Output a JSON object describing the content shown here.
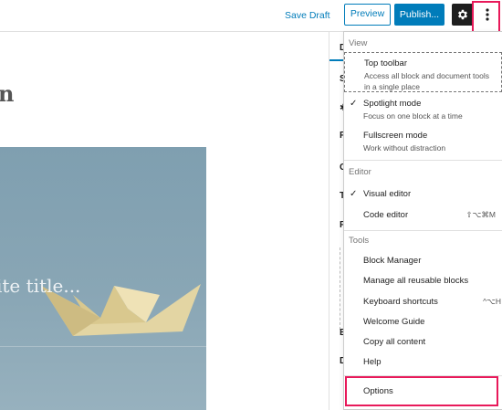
{
  "toolbar": {
    "save_draft": "Save Draft",
    "preview": "Preview",
    "publish": "Publish...",
    "settings_icon": "gear-icon",
    "more_icon": "vertical-ellipsis-icon",
    "highlight_color": "#e8195a",
    "accent_color": "#007cba"
  },
  "editor": {
    "heading_fragment": "n",
    "cover_placeholder": "ite title..."
  },
  "sidebar": {
    "tab_letters": [
      "D",
      "S",
      "P",
      "C",
      "T",
      "F",
      "E",
      "D"
    ]
  },
  "menu": {
    "view": {
      "title": "View",
      "items": [
        {
          "label": "Top toolbar",
          "description": "Access all block and document tools in a single place",
          "checked": false
        },
        {
          "label": "Spotlight mode",
          "description": "Focus on one block at a time",
          "checked": true
        },
        {
          "label": "Fullscreen mode",
          "description": "Work without distraction",
          "checked": false
        }
      ]
    },
    "editor": {
      "title": "Editor",
      "items": [
        {
          "label": "Visual editor",
          "checked": true,
          "shortcut": ""
        },
        {
          "label": "Code editor",
          "checked": false,
          "shortcut": "⇧⌥⌘M"
        }
      ]
    },
    "tools": {
      "title": "Tools",
      "items": [
        {
          "label": "Block Manager",
          "shortcut": ""
        },
        {
          "label": "Manage all reusable blocks",
          "shortcut": ""
        },
        {
          "label": "Keyboard shortcuts",
          "shortcut": "^⌥H"
        },
        {
          "label": "Welcome Guide",
          "shortcut": ""
        },
        {
          "label": "Copy all content",
          "shortcut": ""
        },
        {
          "label": "Help",
          "shortcut": ""
        }
      ]
    },
    "options": {
      "label": "Options"
    },
    "check_glyph": "✓"
  }
}
